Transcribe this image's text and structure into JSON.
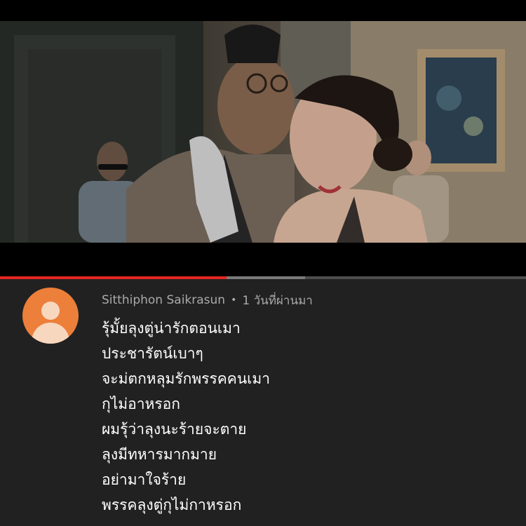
{
  "video": {
    "progress_played": 0.43,
    "progress_buffered": 0.58
  },
  "comment": {
    "author": "Sitthiphon Saikrasun",
    "separator": "•",
    "timestamp": "1 วันที่ผ่านมา",
    "lines": [
      "รุ้มั้ยลุงตู่น่ารักตอนเมา",
      "ประชารัตน์เบาๆ",
      "จะม่ตกหลุมรักพรรคคนเมา",
      "กุไม่อาหรอก",
      "ผมรุ้ว่าลุงนะร้ายจะตาย",
      "ลุงมีทหารมากมาย",
      "อย่ามาใจร้าย",
      "พรรคลุงตู่กุไม่กาหรอก"
    ]
  },
  "colors": {
    "progress_played": "#e52521",
    "avatar_bg": "#ec7f3a",
    "panel_bg": "#212121"
  }
}
